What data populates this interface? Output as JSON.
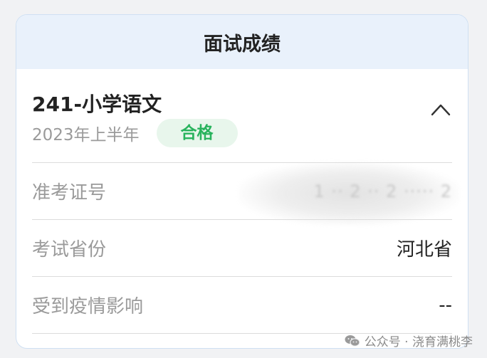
{
  "header": {
    "title": "面试成绩"
  },
  "summary": {
    "subject": "241-小学语文",
    "term": "2023年上半年",
    "status_badge": "合格",
    "collapse_icon": "chevron-up-icon"
  },
  "rows": [
    {
      "label": "准考证号",
      "value": "1 ·· 2 ·· 2 ····· 2"
    },
    {
      "label": "考试省份",
      "value": "河北省"
    },
    {
      "label": "受到疫情影响",
      "value": "--"
    }
  ],
  "watermark": {
    "text": "公众号 · 浇育满桃李",
    "icon": "wechat-icon"
  },
  "colors": {
    "header_bg": "#e9f1fb",
    "badge_bg": "#e8f6ec",
    "badge_text": "#28b35d",
    "border": "#cfe0f3"
  }
}
